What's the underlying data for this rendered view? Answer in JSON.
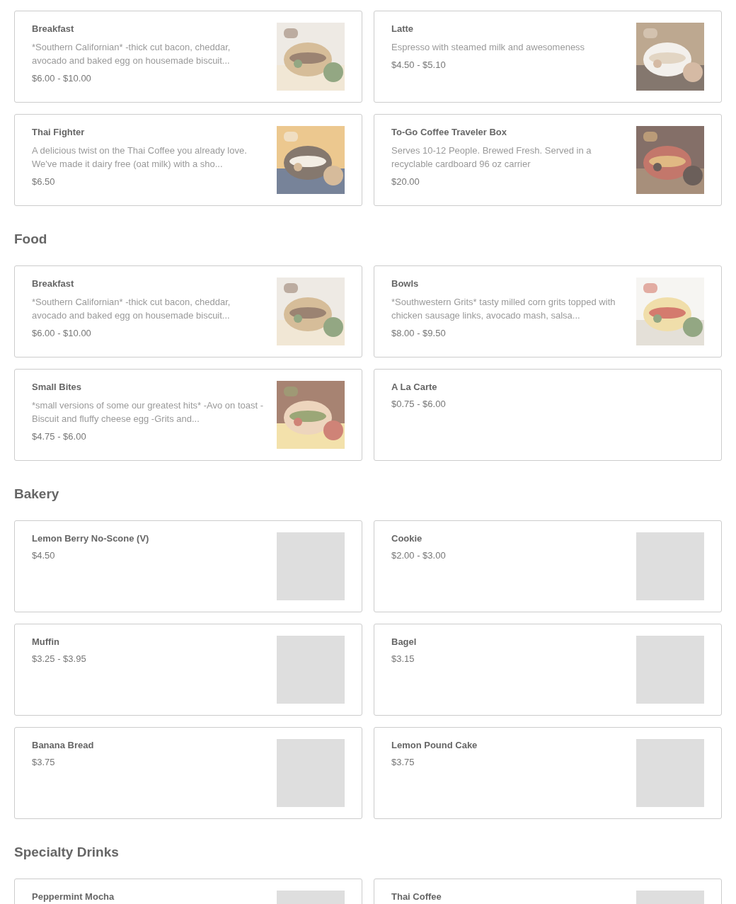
{
  "sections": [
    {
      "items": [
        {
          "name": "Breakfast",
          "description": "*Southern Californian* -thick cut bacon, cheddar, avocado and baked egg on housemade biscuit...",
          "price": "$6.00 - $10.00"
        },
        {
          "name": "Latte",
          "description": "Espresso with steamed milk and awesomeness",
          "price": "$4.50 - $5.10"
        },
        {
          "name": "Thai Fighter",
          "description": "A delicious twist on the Thai Coffee you already love. We've made it dairy free (oat milk) with a sho...",
          "price": "$6.50"
        },
        {
          "name": "To-Go Coffee Traveler Box",
          "description": "Serves 10-12 People. Brewed Fresh. Served in a recyclable cardboard 96 oz carrier",
          "price": "$20.00"
        }
      ]
    },
    {
      "title": "Food",
      "items": [
        {
          "name": "Breakfast",
          "description": "*Southern Californian* -thick cut bacon, cheddar, avocado and baked egg on housemade biscuit...",
          "price": "$6.00 - $10.00"
        },
        {
          "name": "Bowls",
          "description": "*Southwestern Grits* tasty milled corn grits topped with chicken sausage links, avocado mash, salsa...",
          "price": "$8.00 - $9.50"
        },
        {
          "name": "Small Bites",
          "description": "*small versions of some our greatest hits* -Avo on toast -Biscuit and fluffy cheese egg -Grits and...",
          "price": "$4.75 - $6.00"
        },
        {
          "name": "A La Carte",
          "price": "$0.75 - $6.00"
        }
      ]
    },
    {
      "title": "Bakery",
      "items": [
        {
          "name": "Lemon Berry No-Scone (V)",
          "price": "$4.50",
          "image": {
            "kind": "placeholder"
          }
        },
        {
          "name": "Cookie",
          "price": "$2.00 - $3.00",
          "image": {
            "kind": "placeholder"
          }
        },
        {
          "name": "Muffin",
          "price": "$3.25 - $3.95",
          "image": {
            "kind": "placeholder"
          }
        },
        {
          "name": "Bagel",
          "price": "$3.15",
          "image": {
            "kind": "placeholder"
          }
        },
        {
          "name": "Banana Bread",
          "price": "$3.75",
          "image": {
            "kind": "placeholder"
          }
        },
        {
          "name": "Lemon Pound Cake",
          "price": "$3.75",
          "image": {
            "kind": "placeholder"
          }
        }
      ]
    },
    {
      "title": "Specialty Drinks",
      "items": [
        {
          "name": "Peppermint Mocha",
          "image": {
            "kind": "placeholder"
          }
        },
        {
          "name": "Thai Coffee",
          "image": {
            "kind": "placeholder"
          }
        }
      ]
    }
  ]
}
